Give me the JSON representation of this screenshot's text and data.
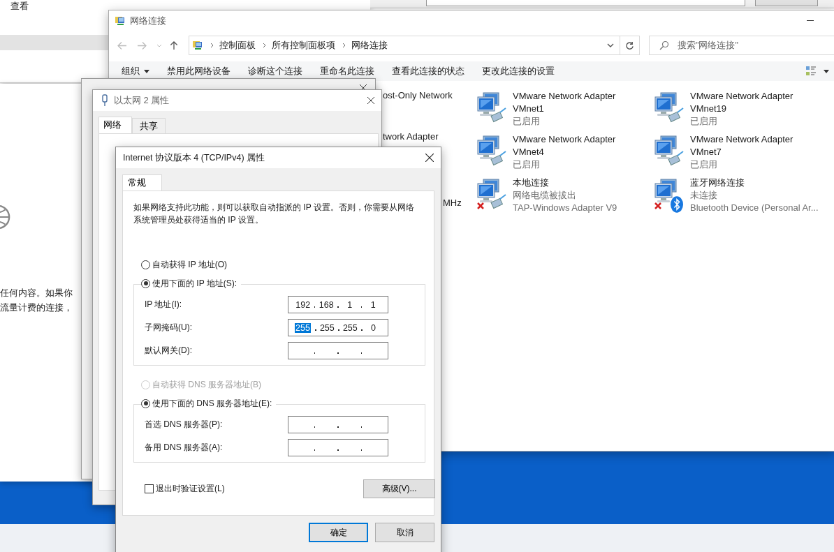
{
  "back_window": {
    "text": "查看"
  },
  "left_window": {
    "lines": [
      "任何内容。如果你",
      "流量计费的连接，"
    ]
  },
  "explorer": {
    "title": "网络连接",
    "breadcrumb": [
      "控制面板",
      "所有控制面板项",
      "网络连接"
    ],
    "search": {
      "placeholder": "搜索\"网络连接\""
    },
    "toolbar": [
      {
        "label": "组织",
        "dropdown": true
      },
      {
        "label": "禁用此网络设备",
        "dropdown": false
      },
      {
        "label": "诊断这个连接",
        "dropdown": false
      },
      {
        "label": "重命名此连接",
        "dropdown": false
      },
      {
        "label": "查看此连接的状态",
        "dropdown": false
      },
      {
        "label": "更改此连接的设置",
        "dropdown": false
      }
    ],
    "partial_column": [
      "ost-Only Network",
      "twork Adapter",
      "MHz"
    ],
    "adapters": [
      {
        "kind": "ethernet",
        "disconnected": false,
        "lines": [
          "VMware Network Adapter",
          "VMnet1",
          "已启用"
        ]
      },
      {
        "kind": "ethernet",
        "disconnected": false,
        "lines": [
          "VMware Network Adapter",
          "VMnet19",
          "已启用"
        ]
      },
      {
        "kind": "ethernet",
        "disconnected": false,
        "lines": [
          "VMware Network Adapter",
          "VMnet4",
          "已启用"
        ]
      },
      {
        "kind": "ethernet",
        "disconnected": false,
        "lines": [
          "VMware Network Adapter",
          "VMnet7",
          "已启用"
        ]
      },
      {
        "kind": "ethernet",
        "disconnected": true,
        "lines": [
          "本地连接",
          "网络电缆被拔出",
          "TAP-Windows Adapter V9"
        ]
      },
      {
        "kind": "bluetooth",
        "disconnected": true,
        "lines": [
          "蓝牙网络连接",
          "未连接",
          "Bluetooth Device (Personal Ar..."
        ]
      }
    ]
  },
  "properties": {
    "title": "以太网 2 属性",
    "tabs": [
      {
        "label": "网络",
        "selected": true
      },
      {
        "label": "共享",
        "selected": false
      }
    ]
  },
  "dialog": {
    "title": "Internet 协议版本 4 (TCP/IPv4) 属性",
    "tabs": [
      {
        "label": "常规",
        "selected": true
      }
    ],
    "description": "如果网络支持此功能，则可以获取自动指派的 IP 设置。否则，你需要从网络系统管理员处获得适当的 IP 设置。",
    "ip_options": [
      {
        "label": "自动获得 IP 地址(O)",
        "selected": false,
        "disabled": false
      },
      {
        "label": "使用下面的 IP 地址(S):",
        "selected": true,
        "disabled": false
      }
    ],
    "ip_fields": [
      {
        "label": "IP 地址(I):",
        "octets": [
          {
            "text": "192",
            "selected": false
          },
          {
            "text": "168",
            "selected": false
          },
          {
            "text": "1",
            "selected": false
          },
          {
            "text": "1",
            "selected": false
          }
        ]
      },
      {
        "label": "子网掩码(U):",
        "octets": [
          {
            "text": "255",
            "selected": true
          },
          {
            "text": "255",
            "selected": false
          },
          {
            "text": "255",
            "selected": false
          },
          {
            "text": "0",
            "selected": false
          }
        ]
      },
      {
        "label": "默认网关(D):"
      }
    ],
    "dns_options": [
      {
        "label": "自动获得 DNS 服务器地址(B)",
        "selected": false,
        "disabled": true
      },
      {
        "label": "使用下面的 DNS 服务器地址(E):",
        "selected": true,
        "disabled": false
      }
    ],
    "dns_fields": [
      {
        "label": "首选 DNS 服务器(P):"
      },
      {
        "label": "备用 DNS 服务器(A):"
      }
    ],
    "validate": {
      "label": "退出时验证设置(L)",
      "checked": false
    },
    "advanced_button": "高级(V)...",
    "buttons": [
      {
        "label": "确定",
        "default": true
      },
      {
        "label": "取消",
        "default": false
      }
    ]
  }
}
